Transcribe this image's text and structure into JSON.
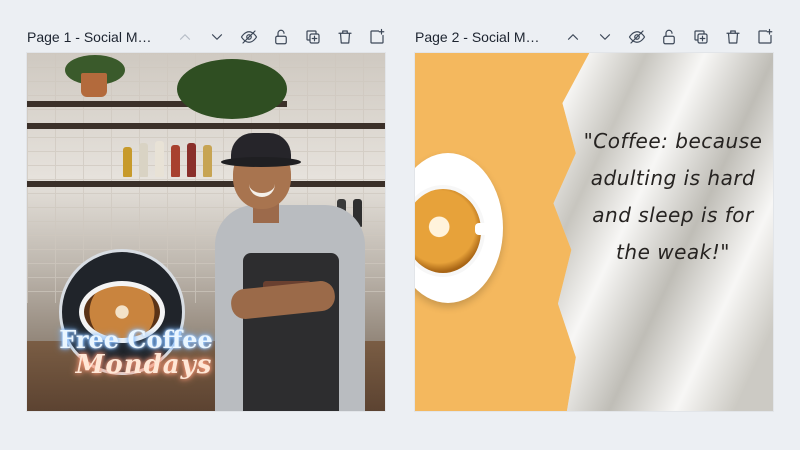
{
  "pages": [
    {
      "title": "Page 1 - Social Media",
      "promo": {
        "line1": "Free Coffee",
        "line2": "Mondays"
      }
    },
    {
      "title": "Page 2 - Social Media",
      "quote": "\"Coffee: because adulting is hard and sleep is for the weak!\""
    }
  ],
  "toolbar_icons": [
    "chevron-up-icon",
    "chevron-down-icon",
    "eye-off-icon",
    "unlock-icon",
    "duplicate-icon",
    "trash-icon",
    "add-page-icon"
  ],
  "colors": {
    "background": "#eceff3",
    "accent_yellow": "#f4b85e"
  }
}
